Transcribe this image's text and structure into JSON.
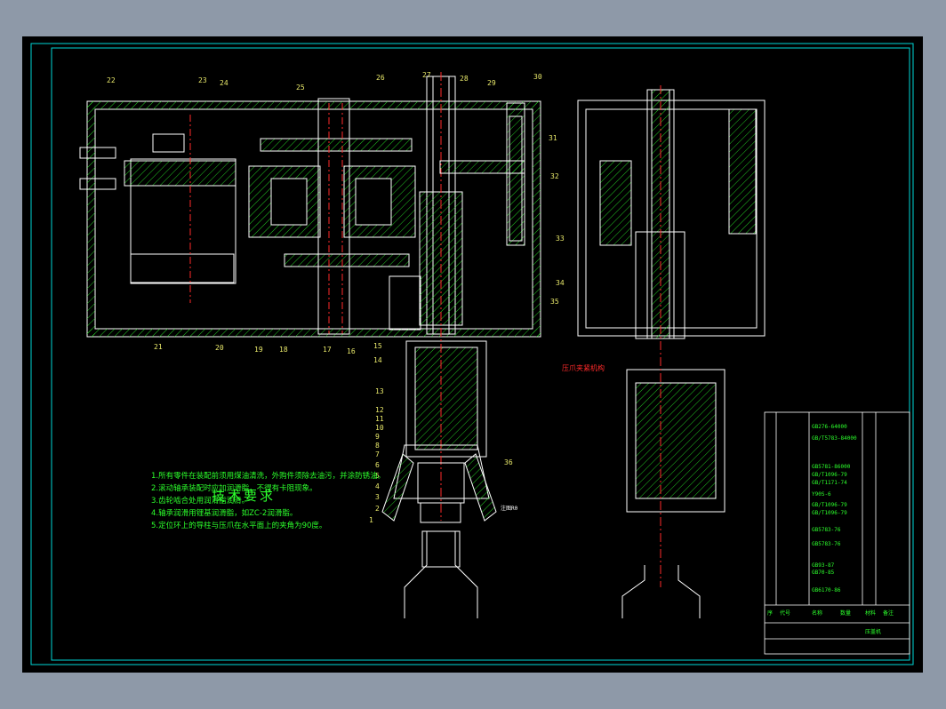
{
  "tech_requirements": {
    "title": "技术要求",
    "lines": [
      "1.所有零件在装配前须用煤油清洗，外购件须除去油污，并涂防锈油。",
      "2.滚动轴承装配时应加润滑脂，不得有卡阻现象。",
      "3.齿轮啮合处用润滑脂润滑。",
      "4.轴承润滑用锂基润滑脂，如ZC-2润滑脂。",
      "5.定位环上的导柱与压爪在水平面上的夹角为90度。"
    ]
  },
  "part_numbers": [
    "22",
    "23",
    "24",
    "25",
    "26",
    "27",
    "28",
    "29",
    "30",
    "31",
    "32",
    "33",
    "34",
    "35",
    "21",
    "20",
    "19",
    "18",
    "17",
    "16",
    "15",
    "14",
    "13",
    "12",
    "11",
    "10",
    "9",
    "8",
    "7",
    "6",
    "5",
    "4",
    "3",
    "2",
    "1",
    "36"
  ],
  "annotations": {
    "section_label": "压爪夹紧机构",
    "side_label": "注图R0"
  },
  "title_block": {
    "standards": [
      "GB276-64000",
      "GB/T5783-84000",
      "GB5781-86000",
      "GB/T1096-79",
      "GB/T1171-74",
      "Y90S-6",
      "GB/T1096-79",
      "GB/T1096-79",
      "GB5783-76",
      "GB5783-76",
      "GB93-87",
      "GB70-85",
      "GB6170-86"
    ],
    "footer": [
      "序",
      "代号",
      "名称",
      "数量",
      "材料",
      "备注"
    ],
    "title": "压盖机"
  },
  "colors": {
    "outline": "#ffffff",
    "green": "#2cff2c",
    "red": "#ff2a2a",
    "yellow": "#e8e86a",
    "cyan": "#00d8d8",
    "hatch": "#2cff2c"
  }
}
